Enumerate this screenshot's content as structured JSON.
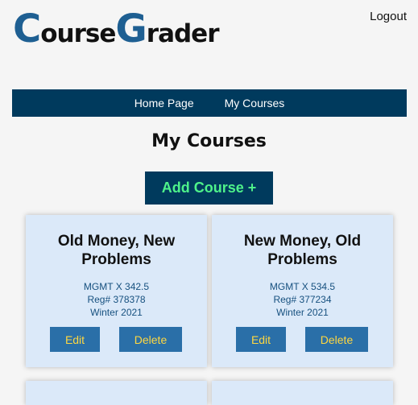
{
  "app": {
    "logo_c": "C",
    "logo_ourse": "ourse",
    "logo_g": "G",
    "logo_rader": "rader"
  },
  "header": {
    "logout_label": "Logout"
  },
  "nav": {
    "home_label": "Home Page",
    "courses_label": "My Courses"
  },
  "main": {
    "title": "My Courses",
    "add_label": "Add Course +",
    "courses": [
      {
        "title_line1": "Old Money, New",
        "title_line2": "Problems",
        "code": "MGMT X 342.5",
        "reg": "Reg# 378378",
        "term": "Winter 2021",
        "edit_label": "Edit",
        "delete_label": "Delete"
      },
      {
        "title_line1": "New Money, Old",
        "title_line2": "Problems",
        "code": "MGMT X 534.5",
        "reg": "Reg# 377234",
        "term": "Winter 2021",
        "edit_label": "Edit",
        "delete_label": "Delete"
      }
    ]
  },
  "colors": {
    "brand_blue": "#1e5f92",
    "navbar": "#003a5d",
    "add_text": "#4ef28a",
    "card_bg": "#dbe9f9",
    "button_bg": "#2a6fa8",
    "button_text": "#ffd740"
  }
}
